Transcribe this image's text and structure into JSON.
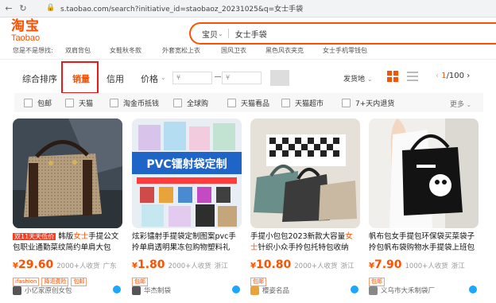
{
  "browser": {
    "url": "s.taobao.com/search?initiative_id=staobaoz_20231025&q=女士手袋"
  },
  "logo": {
    "cn": "淘宝",
    "en": "Taobao"
  },
  "search": {
    "scope": "宝贝",
    "query": "女士手袋"
  },
  "hotwords": [
    "您是不是想找:",
    "双肩背包",
    "女鞋秋冬款",
    "外套宽松上衣",
    "国风卫衣",
    "黑色风衣夹克",
    "女士手机零钱包"
  ],
  "sortbar": {
    "items": [
      "综合排序",
      "销量",
      "信用",
      "价格"
    ],
    "price_min_placeholder": "¥",
    "price_max_placeholder": "¥",
    "ship_from": "发货地",
    "page_current": "1",
    "page_total": "/100"
  },
  "filters": [
    "包邮",
    "天猫",
    "淘金币抵钱",
    "全球购",
    "天猫看品",
    "天猫超市",
    "7+天内退货"
  ],
  "filter_more": "更多",
  "products": [
    {
      "tag": "双11天天低价",
      "title_pre": "韩版",
      "title_hl": "女士",
      "title_post": "手提公文包职业通勤菜纹简约单肩大包",
      "currency": "¥",
      "price": "29.60",
      "sold": "2000+人收货",
      "location": "广东",
      "badges": [
        "ifashion",
        "降退费险",
        "包邮"
      ],
      "shop": "小亿家原创女包"
    },
    {
      "tag": "",
      "title_pre": "炫彩镭射手提袋定制图案pvc手拎单肩透明果冻包购物塑料礼",
      "title_hl": "",
      "title_post": "",
      "currency": "¥",
      "price": "1.80",
      "sold": "2000+人收货",
      "location": "浙江",
      "badges": [
        "包邮"
      ],
      "shop": "华杰制袋"
    },
    {
      "tag": "",
      "title_pre": "手提小包包2023新款大容量",
      "title_hl": "女士",
      "title_post": "针织小众手拎包托特包收纳",
      "currency": "¥",
      "price": "10.80",
      "sold": "2000+人收货",
      "location": "浙江",
      "badges": [
        "包邮"
      ],
      "shop": "樱姿名品"
    },
    {
      "tag": "",
      "title_pre": "帆布包女手提包环保袋买菜袋子拎包帆布袋购物水手提袋上班包",
      "title_hl": "",
      "title_post": "",
      "currency": "¥",
      "price": "7.90",
      "sold": "1000+人收货",
      "location": "浙江",
      "badges": [
        "包邮"
      ],
      "shop": "义乌市大禾制袋厂"
    }
  ]
}
